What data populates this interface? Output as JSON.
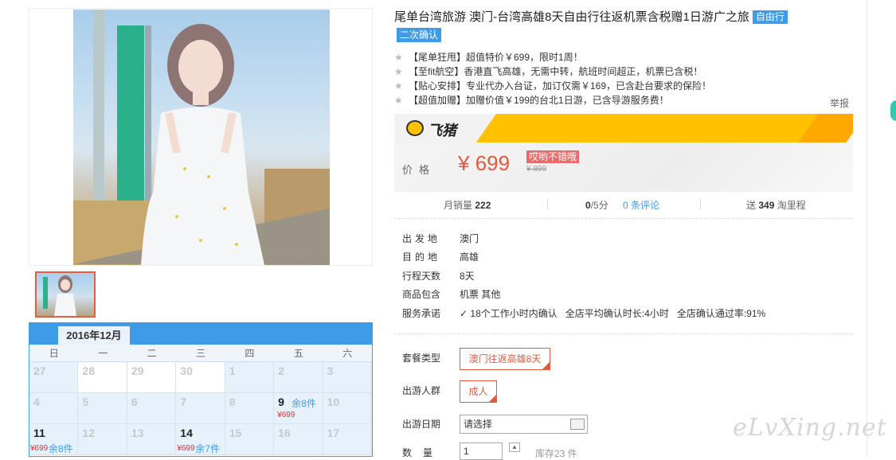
{
  "product": {
    "title": "尾单台湾旅游 澳门-台湾高雄8天自由行往返机票含税赠1日游广之旅",
    "tag_free": "自由行",
    "tag_confirm": "二次确认",
    "features": [
      "【尾单狂甩】超值特价￥699，限时1周！",
      "【至fit航空】香港直飞高雄，无需中转，航班时间超正，机票已含税！",
      "【贴心安排】专业代办入台证，加订仅需￥169，已含赴台要求的保险！",
      "【超值加赠】加赠价值￥199的台北1日游，已含导游服务费！"
    ],
    "report": "举报"
  },
  "brand": {
    "name": "飞猪"
  },
  "price": {
    "label": "价格",
    "currency": "¥",
    "amount": "699",
    "badge": "哎哟不错哦",
    "original": "¥ 899"
  },
  "stats": {
    "monthly_sales_label": "月销量",
    "monthly_sales": "222",
    "rating": "0",
    "rating_suffix": "/5分",
    "reviews": "0 条评论",
    "mileage_prefix": "送",
    "mileage": "349",
    "mileage_suffix": "淘里程"
  },
  "details": {
    "departure_label": "出发地",
    "departure": "澳门",
    "destination_label": "目的地",
    "destination": "高雄",
    "days_label": "行程天数",
    "days": "8天",
    "includes_label": "商品包含",
    "includes": "机票  其他",
    "promise_label": "服务承诺",
    "promise_1": "18个工作小时内确认",
    "promise_2": "全店平均确认时长:4小时",
    "promise_3": "全店确认通过率:91%"
  },
  "options": {
    "package_label": "套餐类型",
    "package_value": "澳门往返高雄8天",
    "group_label": "出游人群",
    "group_value": "成人",
    "date_label": "出游日期",
    "date_placeholder": "请选择",
    "qty_label": "数量",
    "qty_value": "1",
    "stock": "库存23 件"
  },
  "calendar": {
    "month": "2016年12月",
    "weekdays": [
      "日",
      "一",
      "二",
      "三",
      "四",
      "五",
      "六"
    ],
    "row1": [
      "27",
      "28",
      "29",
      "30",
      "1",
      "2",
      "3"
    ],
    "row2": [
      "4",
      "5",
      "6",
      "7",
      "8",
      "9",
      "10"
    ],
    "row3": [
      "11",
      "12",
      "13",
      "14",
      "15",
      "16",
      "17"
    ],
    "day9_remaining": "余8件",
    "day9_price": "¥699",
    "day11_price": "¥699",
    "day11_remaining": "余8件",
    "day14_price": "¥699",
    "day14_remaining": "余7件"
  },
  "watermark": "eLvXing.net",
  "colors": {
    "accent": "#3d9be8",
    "price": "#e15a3e",
    "banner": "#ffc100"
  }
}
